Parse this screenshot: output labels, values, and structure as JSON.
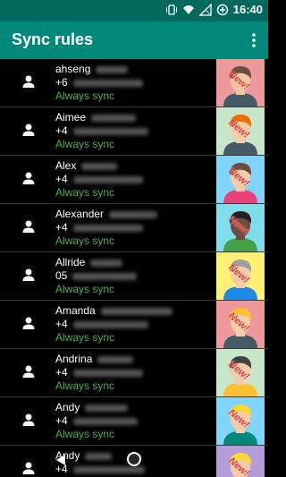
{
  "status": {
    "time": "16:40"
  },
  "app": {
    "title": "Sync rules",
    "menu_icon": "more-vert-icon"
  },
  "contacts": [
    {
      "name": "ahseng",
      "phone": "+6",
      "status": "Always sync",
      "new": "New!",
      "bg": "#ef9a9a",
      "hair": "#6d4c41",
      "skin": "#f2c6a0",
      "shirt": "#455a64"
    },
    {
      "name": "Aimee",
      "phone": "+4",
      "status": "Always sync",
      "new": "New!",
      "bg": "#c8e6c9",
      "hair": "#ef6c00",
      "skin": "#f6cba8",
      "shirt": "#455a64"
    },
    {
      "name": "Alex",
      "phone": "+4",
      "status": "Always sync",
      "new": "New!",
      "bg": "#81d4fa",
      "hair": "#6d4c41",
      "skin": "#f6cba8",
      "shirt": "#ec407a"
    },
    {
      "name": "Alexander",
      "phone": "+4",
      "status": "Always sync",
      "new": "New!",
      "bg": "#80deea",
      "hair": "#212121",
      "skin": "#6d4c41",
      "shirt": "#43a047"
    },
    {
      "name": "Allride",
      "phone": "05",
      "status": "Always sync",
      "new": "New!",
      "bg": "#fff176",
      "hair": "#9e9e9e",
      "skin": "#f6cba8",
      "shirt": "#1e88e5"
    },
    {
      "name": "Amanda",
      "phone": "+4",
      "status": "Always sync",
      "new": "New!",
      "bg": "#ef9a9a",
      "hair": "#fbc02d",
      "skin": "#f6cba8",
      "shirt": "#455a64"
    },
    {
      "name": "Andrina",
      "phone": "+4",
      "status": "Always sync",
      "new": "New!",
      "bg": "#c8e6c9",
      "hair": "#424242",
      "skin": "#f6cba8",
      "shirt": "#fbc02d"
    },
    {
      "name": "Andy",
      "phone": "+4",
      "status": "Always sync",
      "new": "New!",
      "bg": "#81d4fa",
      "hair": "#fdd835",
      "skin": "#f6cba8",
      "shirt": "#00897b"
    },
    {
      "name": "Andy",
      "phone": "+4",
      "status": "",
      "new": "New!",
      "bg": "#b39ddb",
      "hair": "#fdd835",
      "skin": "#f6cba8",
      "shirt": "#e53935"
    }
  ]
}
